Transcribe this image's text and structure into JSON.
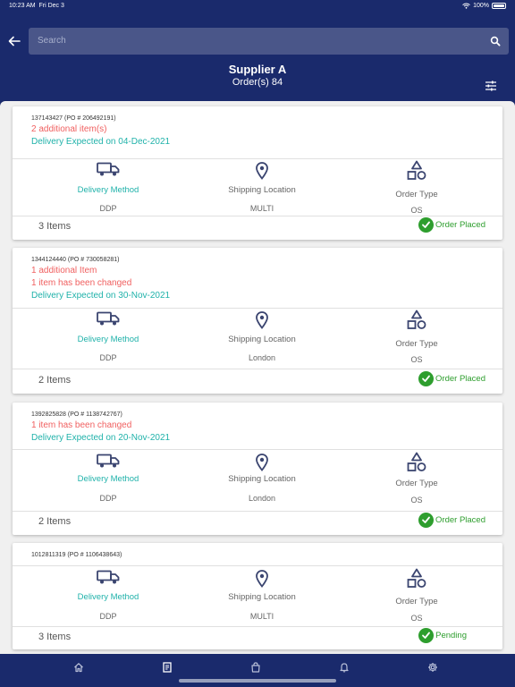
{
  "status_bar": {
    "time": "10:23 AM",
    "date": "Fri Dec 3",
    "battery": "100%"
  },
  "search": {
    "placeholder": "Search"
  },
  "header": {
    "supplier": "Supplier A",
    "orders": "Order(s) 84"
  },
  "labels": {
    "delivery_method": "Delivery Method",
    "shipping_location": "Shipping Location",
    "order_type": "Order Type"
  },
  "orders": [
    {
      "po_line": "137143427 (PO # 206492191)",
      "notes": [
        "2 additional item(s)"
      ],
      "delivery": "Delivery Expected on 04-Dec-2021",
      "delivery_method": "DDP",
      "shipping_location": "MULTI",
      "order_type": "OS",
      "items": "3 Items",
      "status": "Order Placed"
    },
    {
      "po_line": "1344124440 (PO # 730058281)",
      "notes": [
        "1 additional Item",
        "1 item has been changed"
      ],
      "delivery": "Delivery Expected on 30-Nov-2021",
      "delivery_method": "DDP",
      "shipping_location": "London",
      "order_type": "OS",
      "items": "2 Items",
      "status": "Order Placed"
    },
    {
      "po_line": "1392825828 (PO # 1138742767)",
      "notes": [
        "1 item has been changed"
      ],
      "delivery": "Delivery Expected on 20-Nov-2021",
      "delivery_method": "DDP",
      "shipping_location": "London",
      "order_type": "OS",
      "items": "2 Items",
      "status": "Order Placed"
    },
    {
      "po_line": "1012811319 (PO # 1106438643)",
      "notes": [],
      "delivery": "",
      "delivery_method": "DDP",
      "shipping_location": "MULTI",
      "order_type": "OS",
      "items": "3 Items",
      "status": "Pending"
    }
  ],
  "tabs": [
    "home-icon",
    "orders-icon",
    "shopping-bag-icon",
    "bell-icon",
    "gear-icon"
  ],
  "colors": {
    "primary": "#1a2a6c",
    "alert": "#f06060",
    "accent": "#20b2aa",
    "success": "#2e9e2e"
  }
}
